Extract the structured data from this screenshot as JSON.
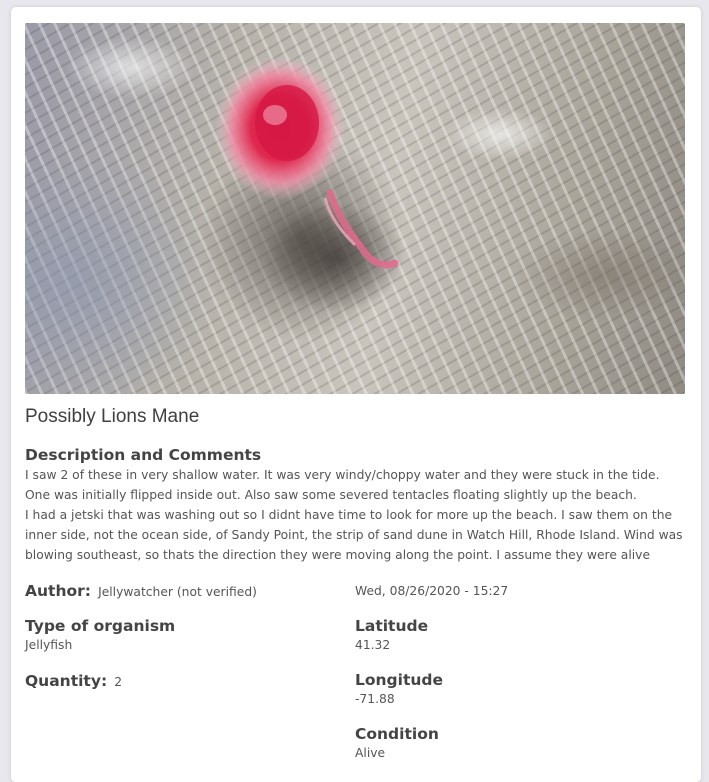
{
  "report": {
    "title": "Possibly Lions Mane",
    "description_label": "Description and Comments",
    "description_paragraphs": [
      "I saw 2 of these in very shallow water. It was very windy/choppy water and they were stuck in the tide. One was initially flipped inside out. Also saw some severed tentacles floating slightly up the beach.",
      "I had a jetski that was washing out so I didnt have time to look for more up the beach. I saw them on the inner side, not the ocean side, of Sandy Point, the strip of sand dune in Watch Hill, Rhode Island. Wind was blowing southeast, so thats the direction they were moving along the point. I assume they were alive"
    ],
    "author_label": "Author:",
    "author_value": "Jellywatcher (not verified)",
    "date": "Wed, 08/26/2020 - 15:27",
    "organism_label": "Type of organism",
    "organism_value": "Jellyfish",
    "latitude_label": "Latitude",
    "latitude_value": "41.32",
    "quantity_label": "Quantity:",
    "quantity_value": "2",
    "longitude_label": "Longitude",
    "longitude_value": "-71.88",
    "condition_label": "Condition",
    "condition_value": "Alive"
  },
  "photo": {
    "subject": "jellyfish in shallow water",
    "colors": {
      "jelly": "#e0284f",
      "jelly_light": "#f08aa4",
      "water": "#b9b5ad"
    }
  }
}
